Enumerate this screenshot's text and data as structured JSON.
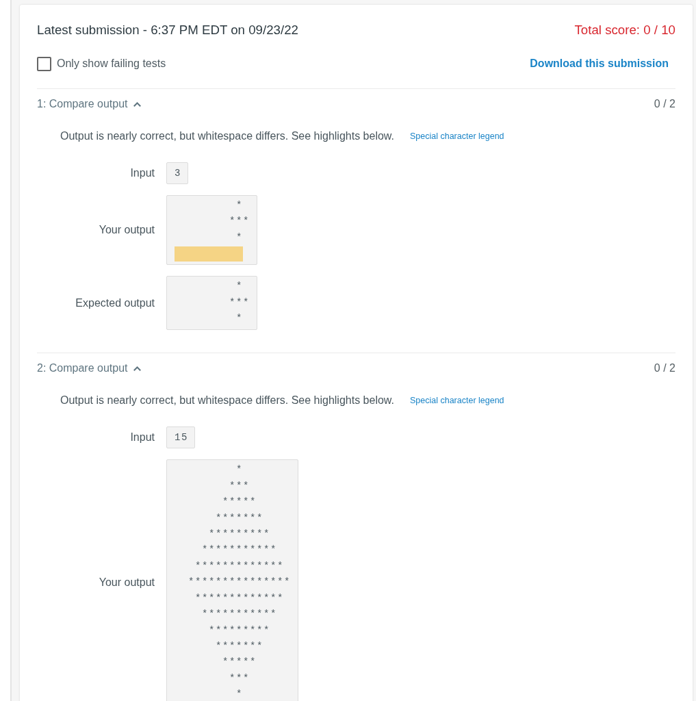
{
  "submission": {
    "title": "Latest submission - 6:37 PM EDT on 09/23/22",
    "total_score": "Total score: 0 / 10"
  },
  "filter": {
    "label": "Only show failing tests",
    "checked": false
  },
  "download_link": "Download this submission",
  "tests": [
    {
      "title": "1: Compare output",
      "expanded": true,
      "score": "0 / 2",
      "message": "Output is nearly correct, but whitespace differs. See highlights below.",
      "legend_link": "Special character legend",
      "rows": [
        {
          "kind": "input",
          "label": "Input",
          "value": "3"
        },
        {
          "kind": "output",
          "label": "Your output",
          "text": "         *\n        ***\n         *",
          "trailing_whitespace_highlighted": true
        },
        {
          "kind": "output",
          "label": "Expected output",
          "text": "         *\n        ***\n         *",
          "trailing_whitespace_highlighted": false
        }
      ]
    },
    {
      "title": "2: Compare output",
      "expanded": true,
      "score": "0 / 2",
      "message": "Output is nearly correct, but whitespace differs. See highlights below.",
      "legend_link": "Special character legend",
      "rows": [
        {
          "kind": "input",
          "label": "Input",
          "value": "15"
        },
        {
          "kind": "output",
          "label": "Your output",
          "text": "         *\n        ***\n       *****\n      *******\n     *********\n    ***********\n   *************\n  ***************\n   *************\n    ***********\n     *********\n      *******\n       *****\n        ***\n         *",
          "trailing_whitespace_highlighted": false
        }
      ]
    }
  ]
}
